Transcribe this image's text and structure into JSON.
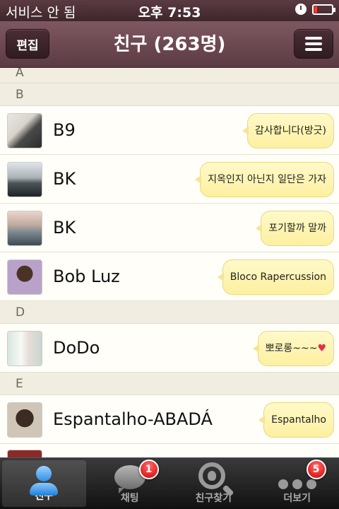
{
  "status": {
    "carrier": "서비스 안 됨",
    "time": "오후 7:53"
  },
  "nav": {
    "edit_label": "편집",
    "title": "친구 (263명)",
    "menu_icon": "menu-icon"
  },
  "sections": [
    {
      "letter": "A"
    },
    {
      "letter": "B"
    },
    {
      "letter": "D"
    },
    {
      "letter": "E"
    }
  ],
  "friends": [
    {
      "name": "B9",
      "status": "감사합니다(방긋)"
    },
    {
      "name": "BK",
      "status": "지옥인지 아닌지 일단은 가자"
    },
    {
      "name": "BK",
      "status": "포기할까 말까"
    },
    {
      "name": "Bob Luz",
      "status": "Bloco Rapercussion"
    },
    {
      "name": "DoDo",
      "status": "뽀로롱~~~",
      "status_icon": "heart-icon"
    },
    {
      "name": "Espantalho-ABADÁ",
      "status": "Espantalho"
    }
  ],
  "tabs": [
    {
      "label": "친구",
      "icon": "person-icon",
      "active": true
    },
    {
      "label": "채팅",
      "icon": "chat-icon",
      "badge": "1"
    },
    {
      "label": "친구찾기",
      "icon": "search-icon"
    },
    {
      "label": "더보기",
      "icon": "more-icon",
      "badge": "5"
    }
  ],
  "colors": {
    "nav_bar": "#6b4a52",
    "bubble": "#fdf3b0",
    "badge": "#e00000",
    "active_tab_icon": "#2d8fe6"
  }
}
